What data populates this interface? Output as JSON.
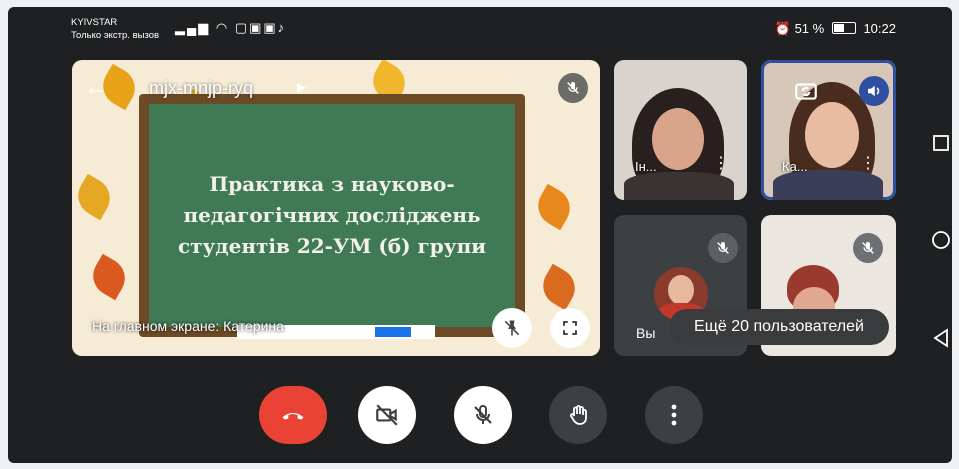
{
  "status_bar": {
    "carrier": "KYIVSTAR",
    "emergency": "Только экстр. вызов",
    "alarm_icon": "alarm-icon",
    "battery_percent": "51 %",
    "time": "10:22"
  },
  "main_tile": {
    "meeting_code": "mjx-mnjp-ryq",
    "board_text": "Практика з науково-педагогічних досліджень студентів 22-УМ (б) групи",
    "caption": "На главном экране: Катерина"
  },
  "participants": [
    {
      "name": "Ін...",
      "muted": false
    },
    {
      "name": "Ка...",
      "muted": false,
      "speaking": true
    },
    {
      "name": "Вы",
      "muted": true
    },
    {
      "name": "",
      "muted": true
    }
  ],
  "more_users_label": "Ещё 20 пользователей",
  "controls": [
    "end-call",
    "camera-off",
    "mic-off",
    "raise-hand",
    "more-options"
  ],
  "colors": {
    "end_call": "#ea4335",
    "background": "#1e2022",
    "active_speaker_border": "#2f4fa0"
  }
}
